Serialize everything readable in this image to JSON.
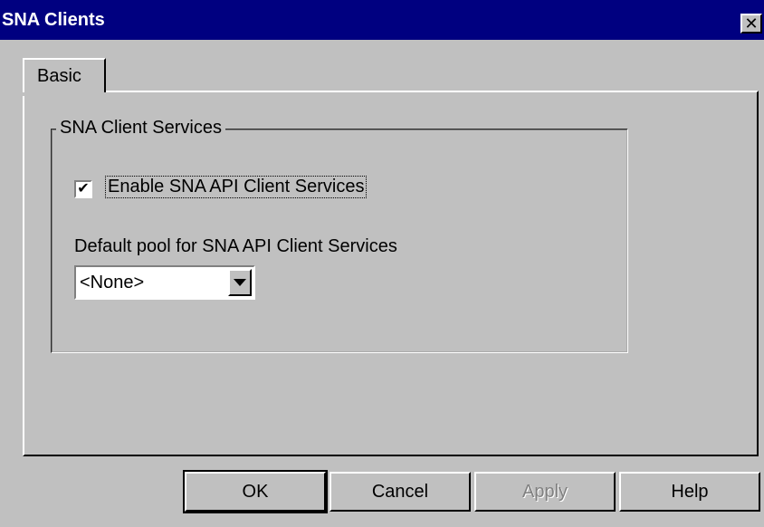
{
  "window": {
    "title": "SNA Clients",
    "close_glyph": "✕"
  },
  "tabs": [
    {
      "label": "Basic",
      "active": true
    }
  ],
  "group": {
    "label": "SNA Client Services",
    "checkbox": {
      "label": "Enable SNA API Client Services",
      "checked": true,
      "mark": "✔"
    },
    "pool_label": "Default pool for SNA API Client Services",
    "pool_select": {
      "value": "<None>"
    }
  },
  "buttons": {
    "ok": "OK",
    "cancel": "Cancel",
    "apply": "Apply",
    "help": "Help"
  },
  "colors": {
    "titlebar": "#000080",
    "face": "#c0c0c0",
    "disabled_text": "#808080"
  },
  "icons": {
    "close": "close-icon",
    "checkbox": "checkmark-icon",
    "dropdown": "chevron-down-icon"
  }
}
